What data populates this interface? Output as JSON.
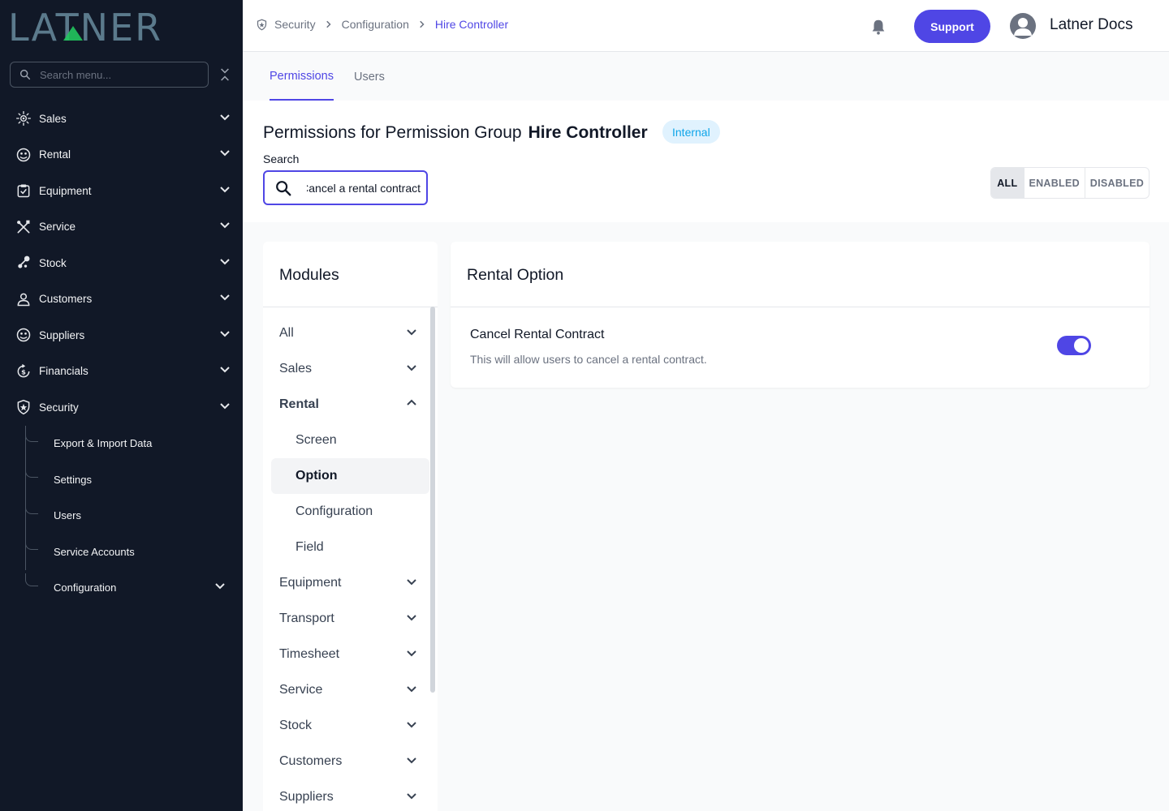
{
  "sidebar": {
    "logo_text": "LATNER",
    "search_placeholder": "Search menu...",
    "items": [
      {
        "label": "Sales",
        "icon": "sales-icon"
      },
      {
        "label": "Rental",
        "icon": "rental-icon"
      },
      {
        "label": "Equipment",
        "icon": "equipment-icon"
      },
      {
        "label": "Service",
        "icon": "service-icon"
      },
      {
        "label": "Stock",
        "icon": "stock-icon"
      },
      {
        "label": "Customers",
        "icon": "customers-icon"
      },
      {
        "label": "Suppliers",
        "icon": "suppliers-icon"
      },
      {
        "label": "Financials",
        "icon": "financials-icon"
      },
      {
        "label": "Security",
        "icon": "security-icon"
      }
    ],
    "security_sub": [
      {
        "label": "Export & Import Data"
      },
      {
        "label": "Settings"
      },
      {
        "label": "Users"
      },
      {
        "label": "Service Accounts"
      },
      {
        "label": "Configuration"
      }
    ]
  },
  "topbar": {
    "breadcrumb": [
      "Security",
      "Configuration",
      "Hire Controller"
    ],
    "support_label": "Support",
    "user_name": "Latner Docs"
  },
  "tabs": [
    {
      "label": "Permissions",
      "active": true
    },
    {
      "label": "Users",
      "active": false
    }
  ],
  "header": {
    "title_prefix": "Permissions for Permission Group",
    "group_name": "Hire Controller",
    "badge": "Internal",
    "search_label": "Search",
    "search_value": "Cancel a rental contract",
    "filters": [
      "ALL",
      "ENABLED",
      "DISABLED"
    ],
    "active_filter": "ALL"
  },
  "modules": {
    "title": "Modules",
    "items": [
      {
        "label": "All"
      },
      {
        "label": "Sales"
      },
      {
        "label": "Rental",
        "open": true,
        "children": [
          "Screen",
          "Option",
          "Configuration",
          "Field"
        ],
        "selected_child": "Option"
      },
      {
        "label": "Equipment"
      },
      {
        "label": "Transport"
      },
      {
        "label": "Timesheet"
      },
      {
        "label": "Service"
      },
      {
        "label": "Stock"
      },
      {
        "label": "Customers"
      },
      {
        "label": "Suppliers"
      }
    ]
  },
  "panel": {
    "title": "Rental Option",
    "permission_name": "Cancel Rental Contract",
    "permission_desc": "This will allow users to cancel a rental contract.",
    "enabled": true
  },
  "colors": {
    "accent": "#4f46e5",
    "sidebar_bg": "#111827",
    "badge_bg": "#e0f2fe",
    "badge_text": "#0ea5e9",
    "logo": "#5b7a8c"
  }
}
